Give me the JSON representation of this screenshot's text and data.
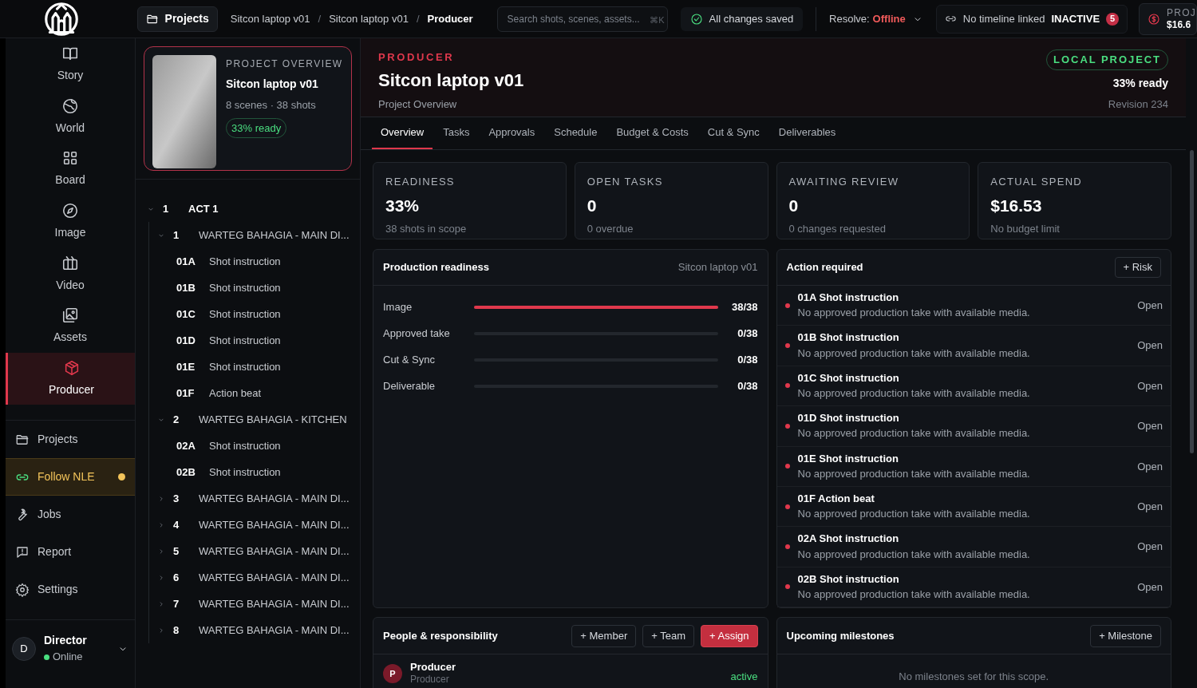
{
  "topbar": {
    "projects_button": "Projects",
    "breadcrumb": [
      "Sitcon laptop v01",
      "Sitcon laptop v01",
      "Producer"
    ],
    "separator": "/",
    "search": {
      "placeholder": "Search shots, scenes, assets...",
      "shortcut": "⌘K"
    },
    "save_status": "All changes saved",
    "resolve": {
      "label": "Resolve:",
      "value": "Offline"
    },
    "timeline": {
      "label": "No timeline linked",
      "state": "INACTIVE",
      "count": "5"
    },
    "spend_card": {
      "label": "PROJ",
      "value": "$16.6"
    }
  },
  "rail": [
    {
      "label": "Story",
      "selected": false
    },
    {
      "label": "World",
      "selected": false
    },
    {
      "label": "Board",
      "selected": false
    },
    {
      "label": "Image",
      "selected": false
    },
    {
      "label": "Video",
      "selected": false
    },
    {
      "label": "Assets",
      "selected": false
    },
    {
      "label": "Producer",
      "selected": true
    }
  ],
  "sidebar_links": [
    {
      "label": "Projects",
      "highlighted": false,
      "dot": false
    },
    {
      "label": "Follow NLE",
      "highlighted": true,
      "dot": true
    },
    {
      "label": "Jobs",
      "highlighted": false,
      "dot": false
    },
    {
      "label": "Report",
      "highlighted": false,
      "dot": false
    },
    {
      "label": "Settings",
      "highlighted": false,
      "dot": false
    }
  ],
  "user": {
    "initial": "D",
    "name": "Director",
    "status": "Online"
  },
  "project_card": {
    "eyebrow": "PROJECT OVERVIEW",
    "title": "Sitcon laptop v01",
    "meta": "8 scenes · 38 shots",
    "badge": "33% ready"
  },
  "tree": [
    {
      "number": "1",
      "title": "ACT 1",
      "expanded": true,
      "children": [
        {
          "number": "1",
          "title": "WARTEG BAHAGIA - MAIN DI...",
          "expanded": true,
          "children": [
            {
              "number": "01A",
              "title": "Shot instruction"
            },
            {
              "number": "01B",
              "title": "Shot instruction"
            },
            {
              "number": "01C",
              "title": "Shot instruction"
            },
            {
              "number": "01D",
              "title": "Shot instruction"
            },
            {
              "number": "01E",
              "title": "Shot instruction"
            },
            {
              "number": "01F",
              "title": "Action beat"
            }
          ]
        },
        {
          "number": "2",
          "title": "WARTEG BAHAGIA - KITCHEN",
          "expanded": true,
          "children": [
            {
              "number": "02A",
              "title": "Shot instruction"
            },
            {
              "number": "02B",
              "title": "Shot instruction"
            }
          ]
        },
        {
          "number": "3",
          "title": "WARTEG BAHAGIA - MAIN DI...",
          "expanded": false
        },
        {
          "number": "4",
          "title": "WARTEG BAHAGIA - MAIN DI...",
          "expanded": false
        },
        {
          "number": "5",
          "title": "WARTEG BAHAGIA - MAIN DI...",
          "expanded": false
        },
        {
          "number": "6",
          "title": "WARTEG BAHAGIA - MAIN DI...",
          "expanded": false
        },
        {
          "number": "7",
          "title": "WARTEG BAHAGIA - MAIN DI...",
          "expanded": false
        },
        {
          "number": "8",
          "title": "WARTEG BAHAGIA - MAIN DI...",
          "expanded": false
        }
      ]
    }
  ],
  "header": {
    "eyebrow": "PRODUCER",
    "title": "Sitcon laptop v01",
    "subtitle": "Project Overview",
    "badge": "LOCAL PROJECT",
    "ready": "33% ready",
    "revision": "Revision 234"
  },
  "tabs": [
    {
      "label": "Overview",
      "selected": true
    },
    {
      "label": "Tasks",
      "selected": false
    },
    {
      "label": "Approvals",
      "selected": false
    },
    {
      "label": "Schedule",
      "selected": false
    },
    {
      "label": "Budget & Costs",
      "selected": false
    },
    {
      "label": "Cut & Sync",
      "selected": false
    },
    {
      "label": "Deliverables",
      "selected": false
    }
  ],
  "stats": [
    {
      "label": "READINESS",
      "value": "33%",
      "note": "38 shots in scope"
    },
    {
      "label": "OPEN TASKS",
      "value": "0",
      "note": "0 overdue"
    },
    {
      "label": "AWAITING REVIEW",
      "value": "0",
      "note": "0 changes requested"
    },
    {
      "label": "ACTUAL SPEND",
      "value": "$16.53",
      "note": "No budget limit"
    }
  ],
  "readiness": {
    "title": "Production readiness",
    "scope": "Sitcon laptop v01",
    "rows": [
      {
        "label": "Image",
        "level": 1,
        "reading": "38/38"
      },
      {
        "label": "Approved take",
        "level": 0,
        "reading": "0/38"
      },
      {
        "label": "Cut & Sync",
        "level": 0,
        "reading": "0/38"
      },
      {
        "label": "Deliverable",
        "level": 0,
        "reading": "0/38"
      }
    ]
  },
  "actions": {
    "title": "Action required",
    "button": "+ Risk",
    "items": [
      {
        "code": "01A",
        "title": "Shot instruction",
        "detail": "No approved production take with available media.",
        "status": "Open",
        "color": "#e0384c"
      },
      {
        "code": "01B",
        "title": "Shot instruction",
        "detail": "No approved production take with available media.",
        "status": "Open",
        "color": "#e0384c"
      },
      {
        "code": "01C",
        "title": "Shot instruction",
        "detail": "No approved production take with available media.",
        "status": "Open",
        "color": "#e0384c"
      },
      {
        "code": "01D",
        "title": "Shot instruction",
        "detail": "No approved production take with available media.",
        "status": "Open",
        "color": "#e0384c"
      },
      {
        "code": "01E",
        "title": "Shot instruction",
        "detail": "No approved production take with available media.",
        "status": "Open",
        "color": "#e0384c"
      },
      {
        "code": "01F",
        "title": "Action beat",
        "detail": "No approved production take with available media.",
        "status": "Open",
        "color": "#e0384c"
      },
      {
        "code": "02A",
        "title": "Shot instruction",
        "detail": "No approved production take with available media.",
        "status": "Open",
        "color": "#e0384c"
      },
      {
        "code": "02B",
        "title": "Shot instruction",
        "detail": "No approved production take with available media.",
        "status": "Open",
        "color": "#e0384c"
      }
    ]
  },
  "people": {
    "title": "People & responsibility",
    "buttons": [
      {
        "label": "+ Member",
        "kind": "plain"
      },
      {
        "label": "+ Team",
        "kind": "plain"
      },
      {
        "label": "+ Assign",
        "kind": "primary"
      }
    ],
    "members": [
      {
        "initial": "P",
        "name": "Producer",
        "role": "Producer",
        "status": "active"
      }
    ]
  },
  "milestones": {
    "title": "Upcoming milestones",
    "button": "+ Milestone",
    "empty": "No milestones set for this scope."
  }
}
